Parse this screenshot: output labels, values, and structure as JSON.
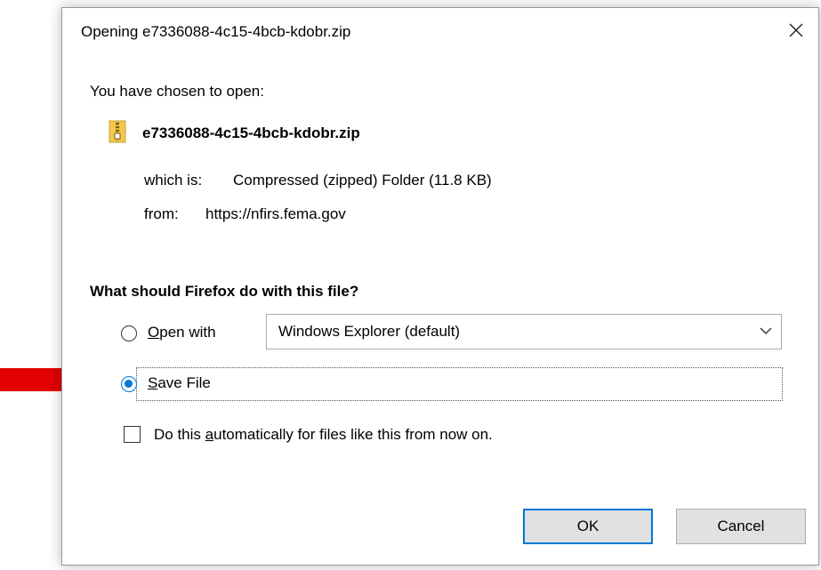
{
  "dialog": {
    "title": "Opening e7336088-4c15-4bcb-kdobr.zip",
    "close_glyph": "✕",
    "intro": "You have chosen to open:",
    "file_name": "e7336088-4c15-4bcb-kdobr.zip",
    "file_icon": "zip-folder-icon",
    "which_is_label": "which is:",
    "which_is_value": "Compressed (zipped) Folder (11.8 KB)",
    "from_label": "from:",
    "from_value": "https://nfirs.fema.gov",
    "question": "What should Firefox do with this file?",
    "open_with": {
      "accesskey": "O",
      "label_rest": "pen with",
      "selected": false,
      "app_value": "Windows Explorer (default)"
    },
    "save_file": {
      "accesskey": "S",
      "label_rest": "ave File",
      "selected": true
    },
    "auto": {
      "prefix": "Do this ",
      "accesskey": "a",
      "suffix": "utomatically for files like this from now on.",
      "checked": false
    },
    "ok_label": "OK",
    "cancel_label": "Cancel"
  },
  "annotation": {
    "arrow_color": "#e30000"
  },
  "colors": {
    "accent": "#0078d7",
    "button_bg": "#e1e1e1"
  }
}
